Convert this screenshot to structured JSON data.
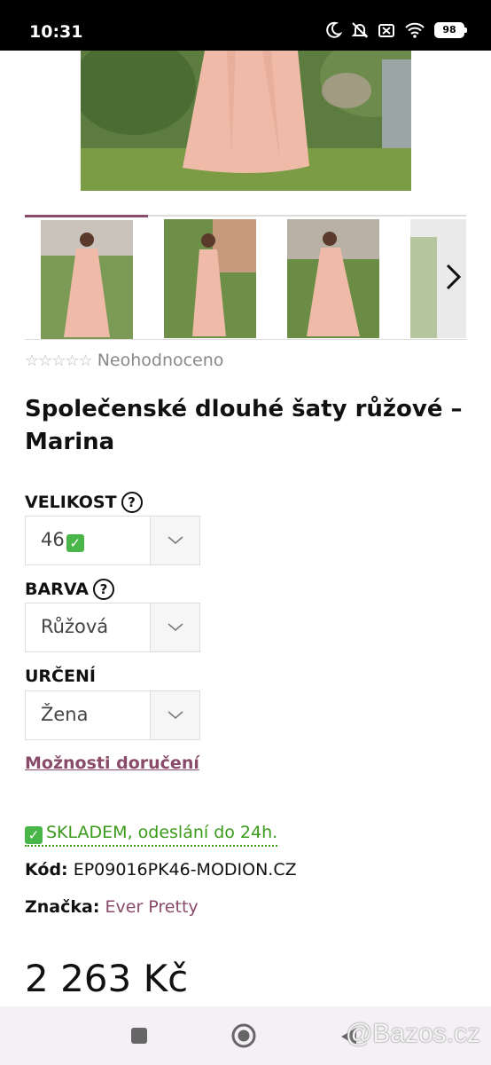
{
  "status_bar": {
    "time": "10:31",
    "battery": "98",
    "icons": [
      "moon-icon",
      "bell-off-icon",
      "sim-off-icon",
      "wifi-icon",
      "battery-icon"
    ]
  },
  "gallery": {
    "thumbnail_count_visible": 4,
    "next_icon": "chevron-right-icon"
  },
  "rating": {
    "stars_text": "☆☆☆☆☆",
    "label": "Neohodnoceno"
  },
  "product": {
    "title": "Společenské dlouhé šaty růžové – Marina"
  },
  "options": {
    "size": {
      "label": "VELIKOST",
      "help": "?",
      "value": "46"
    },
    "color": {
      "label": "BARVA",
      "help": "?",
      "value": "Růžová"
    },
    "purpose": {
      "label": "URČENÍ",
      "value": "Žena"
    }
  },
  "delivery_link": "Možnosti doručení",
  "stock": {
    "check": "✓",
    "text": "SKLADEM, odeslání do 24h."
  },
  "code": {
    "label": "Kód:",
    "value": "EP09016PK46-MODION.CZ"
  },
  "brand": {
    "label": "Značka:",
    "value": "Ever Pretty"
  },
  "price": "2 263 Kč",
  "watermark": "@Bazos.cz",
  "colors": {
    "accent": "#8a4a6a",
    "stock_green": "#3a9a1a"
  }
}
